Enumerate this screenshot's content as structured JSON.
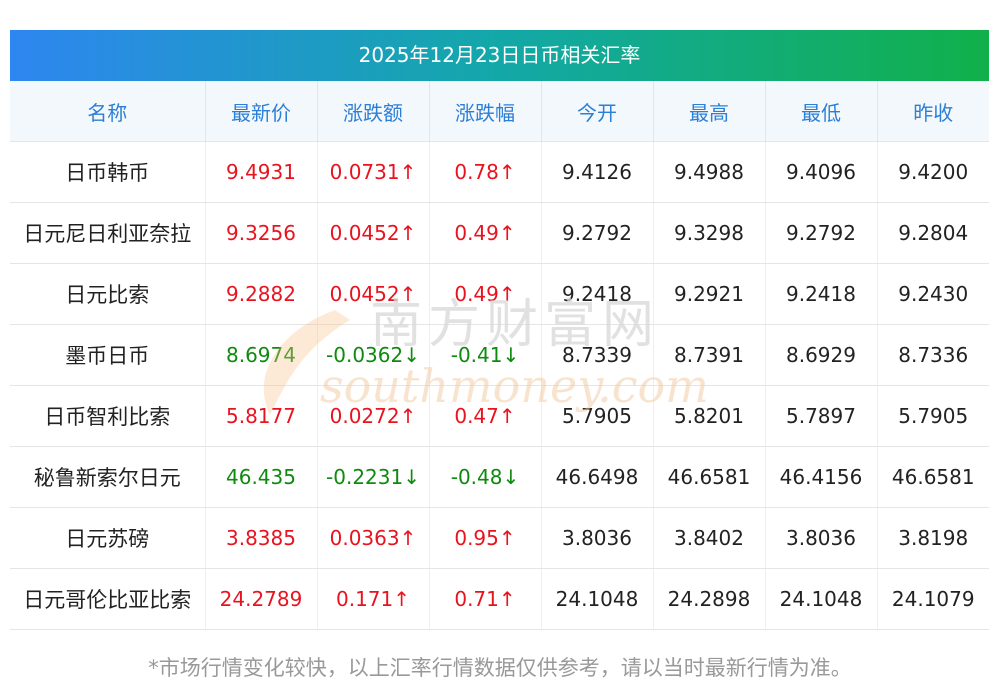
{
  "title": "2025年12月23日日币相关汇率",
  "headers": [
    "名称",
    "最新价",
    "涨跌额",
    "涨跌幅",
    "今开",
    "最高",
    "最低",
    "昨收"
  ],
  "rows": [
    {
      "name": "日币韩币",
      "latest": "9.4931",
      "change": "0.0731↑",
      "change_pct": "0.78↑",
      "open": "9.4126",
      "high": "9.4988",
      "low": "9.4096",
      "prev_close": "9.4200",
      "trend": "up"
    },
    {
      "name": "日元尼日利亚奈拉",
      "latest": "9.3256",
      "change": "0.0452↑",
      "change_pct": "0.49↑",
      "open": "9.2792",
      "high": "9.3298",
      "low": "9.2792",
      "prev_close": "9.2804",
      "trend": "up"
    },
    {
      "name": "日元比索",
      "latest": "9.2882",
      "change": "0.0452↑",
      "change_pct": "0.49↑",
      "open": "9.2418",
      "high": "9.2921",
      "low": "9.2418",
      "prev_close": "9.2430",
      "trend": "up"
    },
    {
      "name": "墨币日币",
      "latest": "8.6974",
      "change": "-0.0362↓",
      "change_pct": "-0.41↓",
      "open": "8.7339",
      "high": "8.7391",
      "low": "8.6929",
      "prev_close": "8.7336",
      "trend": "down"
    },
    {
      "name": "日币智利比索",
      "latest": "5.8177",
      "change": "0.0272↑",
      "change_pct": "0.47↑",
      "open": "5.7905",
      "high": "5.8201",
      "low": "5.7897",
      "prev_close": "5.7905",
      "trend": "up"
    },
    {
      "name": "秘鲁新索尔日元",
      "latest": "46.435",
      "change": "-0.2231↓",
      "change_pct": "-0.48↓",
      "open": "46.6498",
      "high": "46.6581",
      "low": "46.4156",
      "prev_close": "46.6581",
      "trend": "down"
    },
    {
      "name": "日元苏磅",
      "latest": "3.8385",
      "change": "0.0363↑",
      "change_pct": "0.95↑",
      "open": "3.8036",
      "high": "3.8402",
      "low": "3.8036",
      "prev_close": "3.8198",
      "trend": "up"
    },
    {
      "name": "日元哥伦比亚比索",
      "latest": "24.2789",
      "change": "0.171↑",
      "change_pct": "0.71↑",
      "open": "24.1048",
      "high": "24.2898",
      "low": "24.1048",
      "prev_close": "24.1079",
      "trend": "up"
    }
  ],
  "watermark": {
    "cn": "南方财富网",
    "en": "southmoney.com"
  },
  "footnote": "*市场行情变化较快，以上汇率行情数据仅供参考，请以当时最新行情为准。",
  "colors": {
    "up": "#e8131f",
    "down": "#0e8a0e",
    "header_text": "#2c7fd6",
    "title_gradient_start": "#2e86f0",
    "title_gradient_end": "#11b04a"
  }
}
